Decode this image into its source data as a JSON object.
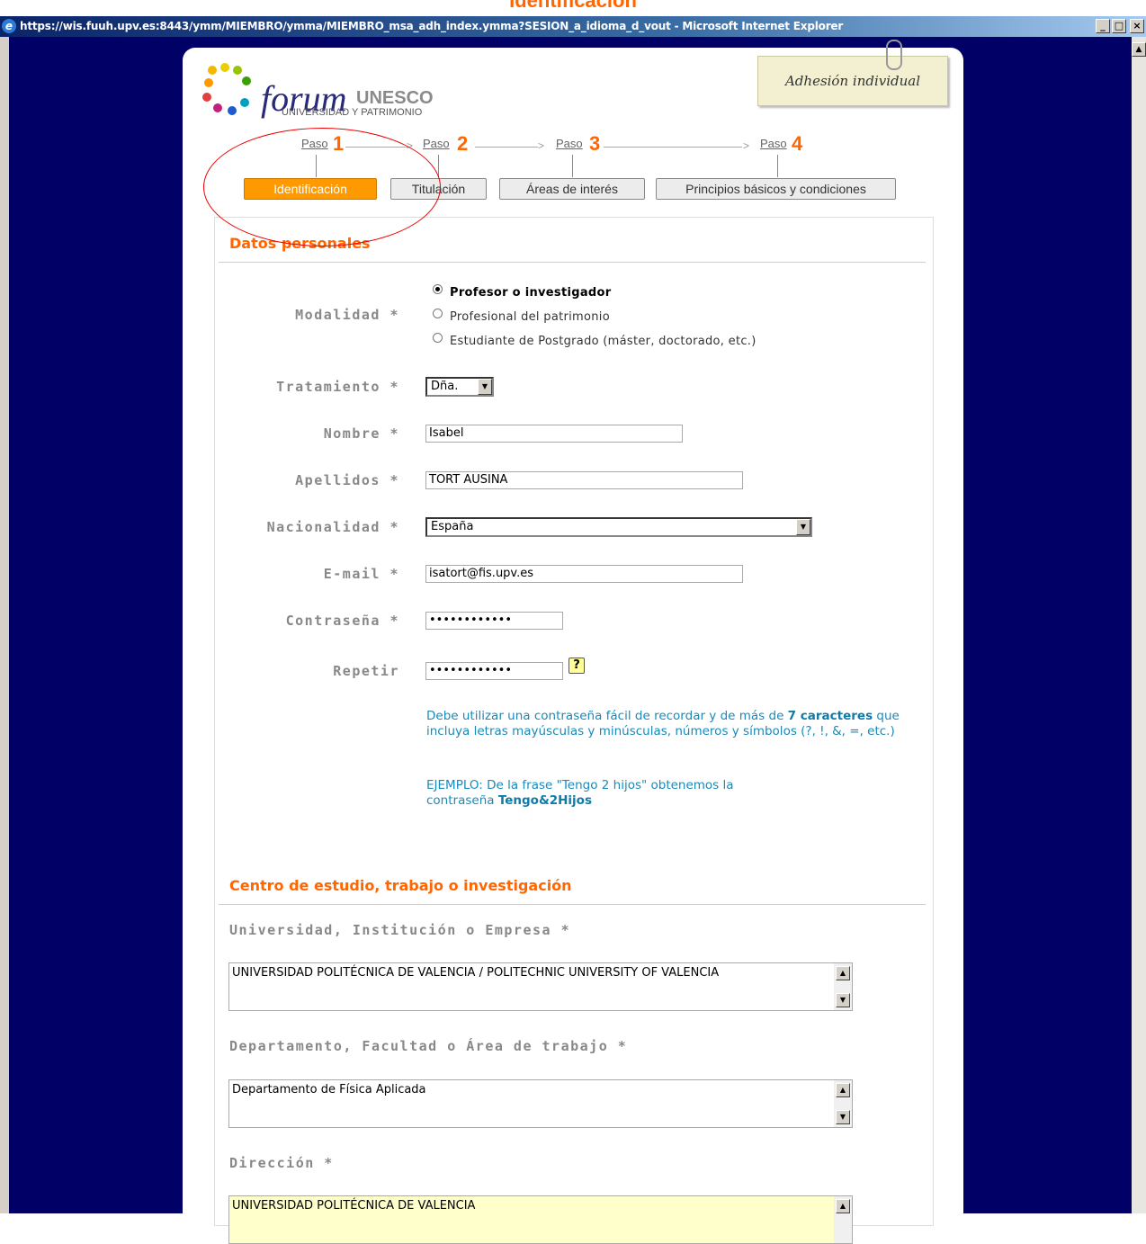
{
  "top_heading": "Identificación",
  "window": {
    "title": "https://wis.fuuh.upv.es:8443/ymm/MIEMBRO/ymma/MIEMBRO_msa_adh_index.ymma?SESION_a_idioma_d_vout - Microsoft Internet Explorer",
    "minimize": "_",
    "maximize": "□",
    "close": "×"
  },
  "logo": {
    "forum": "forum",
    "unesco": "UNESCO",
    "subtitle": "UNIVERSIDAD Y PATRIMONIO"
  },
  "badge": "Adhesión individual",
  "steps": [
    {
      "paso": "Paso",
      "num": "1",
      "label": "Identificación",
      "active": true
    },
    {
      "paso": "Paso",
      "num": "2",
      "label": "Titulación",
      "active": false
    },
    {
      "paso": "Paso",
      "num": "3",
      "label": "Áreas de interés",
      "active": false
    },
    {
      "paso": "Paso",
      "num": "4",
      "label": "Principios básicos y condiciones",
      "active": false
    }
  ],
  "personal": {
    "section_title": "Datos personales",
    "modalidad": {
      "label": "Modalidad *",
      "options": [
        "Profesor o investigador",
        "Profesional del patrimonio",
        "Estudiante de Postgrado (máster, doctorado, etc.)"
      ],
      "selected_index": 0
    },
    "tratamiento": {
      "label": "Tratamiento *",
      "value": "Dña."
    },
    "nombre": {
      "label": "Nombre *",
      "value": "Isabel"
    },
    "apellidos": {
      "label": "Apellidos *",
      "value": "TORT AUSINA"
    },
    "nacionalidad": {
      "label": "Nacionalidad *",
      "value": "España"
    },
    "email": {
      "label": "E-mail *",
      "value": "isatort@fis.upv.es"
    },
    "contrasena": {
      "label": "Contraseña *",
      "value": "••••••••••••"
    },
    "repetir": {
      "label": "Repetir",
      "value": "••••••••••••"
    },
    "help_icon": "?",
    "help1_part1": "Debe utilizar una contraseña fácil de recordar y de más de ",
    "help1_bold": "7 caracteres",
    "help1_part2": " que incluya letras mayúsculas y minúsculas, números y símbolos (?, !, &, =, etc.)",
    "help2_part1": "EJEMPLO: De la frase \"Tengo 2 hijos\" obtenemos la contraseña ",
    "help2_bold": "Tengo&2Hijos"
  },
  "centro": {
    "section_title": "Centro de estudio, trabajo o investigación",
    "universidad": {
      "label": "Universidad, Institución o Empresa *",
      "value": "UNIVERSIDAD POLITÉCNICA DE VALENCIA / POLITECHNIC UNIVERSITY OF VALENCIA"
    },
    "departamento": {
      "label": "Departamento, Facultad o Área de trabajo *",
      "value": "Departamento de Física Aplicada"
    },
    "direccion": {
      "label": "Dirección *",
      "value": "UNIVERSIDAD POLITÉCNICA DE VALENCIA"
    }
  },
  "colors": {
    "accent": "#ff6600",
    "active_step": "#ff9900",
    "help_text": "#1a8ab8",
    "background": "#000066"
  }
}
